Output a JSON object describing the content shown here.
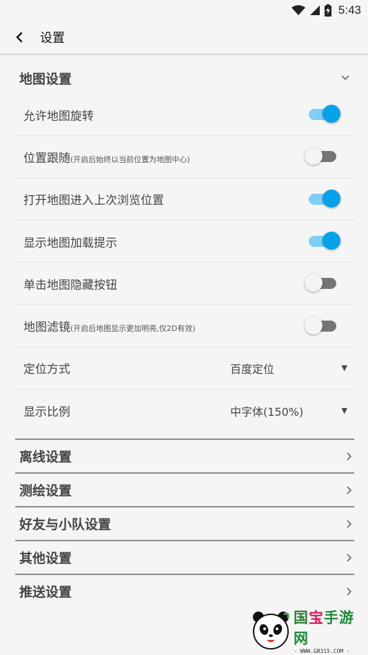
{
  "status_bar": {
    "time": "5:43"
  },
  "app_bar": {
    "title": "设置"
  },
  "map_section": {
    "title": "地图设置",
    "rows": [
      {
        "label": "允许地图旋转",
        "sub": "",
        "type": "switch",
        "on": true
      },
      {
        "label": "位置跟随",
        "sub": "(开启后始终以当前位置为地图中心)",
        "type": "switch",
        "on": false
      },
      {
        "label": "打开地图进入上次浏览位置",
        "sub": "",
        "type": "switch",
        "on": true
      },
      {
        "label": "显示地图加载提示",
        "sub": "",
        "type": "switch",
        "on": true
      },
      {
        "label": "单击地图隐藏按钮",
        "sub": "",
        "type": "switch",
        "on": false
      },
      {
        "label": "地图滤镜",
        "sub": "(开启后地图显示更加明亮,仅2D有效)",
        "type": "switch",
        "on": false
      },
      {
        "label": "定位方式",
        "sub": "",
        "type": "select",
        "value": "百度定位"
      },
      {
        "label": "显示比例",
        "sub": "",
        "type": "select",
        "value": "中字体(150%)"
      }
    ]
  },
  "other_sections": [
    {
      "label": "离线设置"
    },
    {
      "label": "测绘设置"
    },
    {
      "label": "好友与小队设置"
    },
    {
      "label": "其他设置"
    },
    {
      "label": "推送设置"
    }
  ],
  "watermark": {
    "brand_g": "国",
    "brand_b": "宝",
    "brand_rest": "手游网",
    "url": "- WWW.GB315.COM -"
  },
  "colors": {
    "accent": "#05a2ea",
    "accent_track": "#7fcff5",
    "off_track": "#757575"
  }
}
